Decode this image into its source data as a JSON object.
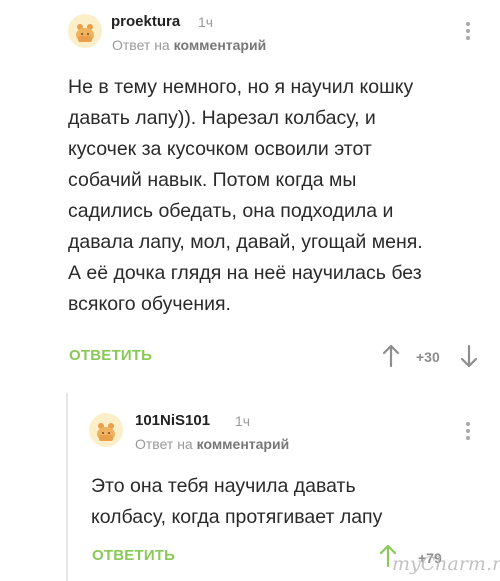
{
  "comments": [
    {
      "username": "proekturа",
      "time": "1ч",
      "reply_prefix": "Ответ на",
      "reply_target": "комментарий",
      "text": "Не в тему немного, но я научил кошку\nдавать лапу)). Нарезал колбасу, и\nкусочек за кусочком освоили этот\nсобачий навык. Потом когда мы\nсадились обедать, она подходила и\nдавала лапу, мол, давай, угощай меня.\nА её дочка глядя на неё научилась без\nвсякого обучения.",
      "reply_label": "ОТВЕТИТЬ",
      "score": "+30",
      "avatar_icon": "bear-cub-avatar",
      "more_icon": "more-vertical-icon"
    },
    {
      "username": "101NiS101",
      "time": "1ч",
      "reply_prefix": "Ответ на",
      "reply_target": "комментарий",
      "text": "Это она тебя научила давать\nколбасу, когда протягивает лапу",
      "reply_label": "ОТВЕТИТЬ",
      "score": "+79",
      "avatar_icon": "bear-cub-avatar",
      "more_icon": "more-vertical-icon"
    }
  ],
  "watermark": "myCharm.ru",
  "colors": {
    "accent_green": "#8ac858",
    "muted_gray": "#9a9a9a",
    "avatar_bg": "#fbefc9",
    "avatar_fg": "#e9a04a"
  }
}
